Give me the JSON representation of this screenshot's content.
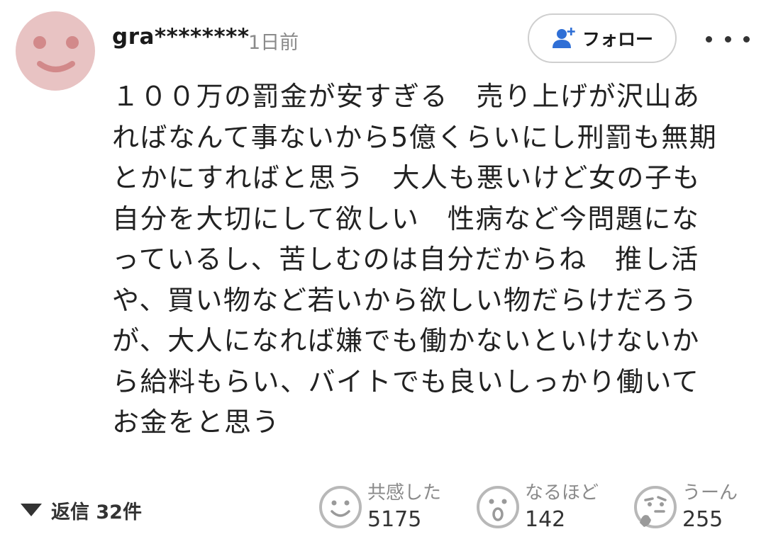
{
  "comment": {
    "username": "gra********",
    "timestamp": "1日前",
    "body": "１００万の罰金が安すぎる　売り上げが沢山あ\nればなんて事ないから5億くらいにし刑罰も無期\nとかにすればと思う　大人も悪いけど女の子も\n自分を大切にして欲しい　性病など今問題にな\nっているし、苦しむのは自分だからね　推し活\nや、買い物など若いから欲しい物だらけだろう\nが、大人になれば嫌でも働かないといけないか\nら給料もらい、バイトでも良いしっかり働いて\nお金をと思う"
  },
  "follow": {
    "label": "フォロー",
    "icon": "add-person-icon"
  },
  "replies": {
    "label": "返信 32件"
  },
  "reactions": [
    {
      "label": "共感した",
      "count": "5175",
      "icon": "smile-face-icon"
    },
    {
      "label": "なるほど",
      "count": "142",
      "icon": "surprised-face-icon"
    },
    {
      "label": "うーん",
      "count": "255",
      "icon": "thinking-face-icon"
    }
  ],
  "colors": {
    "avatar_bg": "#e8c3c3",
    "avatar_features": "#d2898a",
    "follow_icon": "#2f6fd6",
    "muted_text": "#8a8a8a"
  }
}
